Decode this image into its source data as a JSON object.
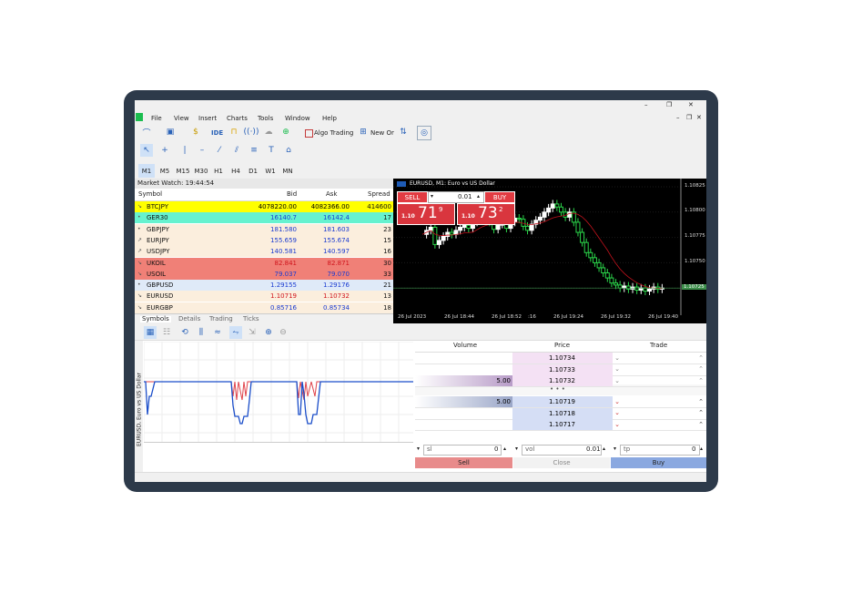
{
  "window": {
    "minimize": "–",
    "maximize": "❐",
    "close": "✕"
  },
  "menu": [
    "File",
    "View",
    "Insert",
    "Charts",
    "Tools",
    "Window",
    "Help"
  ],
  "toolbar": {
    "ide": "IDE",
    "algo_trading": "Algo Trading",
    "new_order": "New Or"
  },
  "timeframes": [
    "M1",
    "M5",
    "M15",
    "M30",
    "H1",
    "H4",
    "D1",
    "W1",
    "MN"
  ],
  "market_watch": {
    "title": "Market Watch: 19:44:54",
    "columns": {
      "symbol": "Symbol",
      "bid": "Bid",
      "ask": "Ask",
      "spread": "Spread"
    },
    "rows": [
      {
        "symbol": "BTCJPY",
        "bid": "4078220.00",
        "ask": "4082366.00",
        "spread": "414600",
        "bg": "#ffff00",
        "color": "#000000",
        "arrow": "↘"
      },
      {
        "symbol": "GER30",
        "bid": "16140.7",
        "ask": "16142.4",
        "spread": "17",
        "bg": "#66f2cf",
        "color": "#1a3bd1",
        "arrow": "•"
      },
      {
        "symbol": "GBPJPY",
        "bid": "181.580",
        "ask": "181.603",
        "spread": "23",
        "bg": "#fbeedd",
        "color": "#1a3bd1",
        "arrow": "•"
      },
      {
        "symbol": "EURJPY",
        "bid": "155.659",
        "ask": "155.674",
        "spread": "15",
        "bg": "#fbeedd",
        "color": "#1a3bd1",
        "arrow": "↗"
      },
      {
        "symbol": "USDJPY",
        "bid": "140.581",
        "ask": "140.597",
        "spread": "16",
        "bg": "#fbeedd",
        "color": "#1a3bd1",
        "arrow": "↗"
      },
      {
        "symbol": "UKOIL",
        "bid": "82.841",
        "ask": "82.871",
        "spread": "30",
        "bg": "#f08077",
        "color": "#d0141c",
        "arrow": "↘"
      },
      {
        "symbol": "USOIL",
        "bid": "79.037",
        "ask": "79.070",
        "spread": "33",
        "bg": "#f08077",
        "color": "#1a3bd1",
        "arrow": "↘"
      },
      {
        "symbol": "GBPUSD",
        "bid": "1.29155",
        "ask": "1.29176",
        "spread": "21",
        "bg": "#dfeaf8",
        "color": "#1a3bd1",
        "arrow": "•"
      },
      {
        "symbol": "EURUSD",
        "bid": "1.10719",
        "ask": "1.10732",
        "spread": "13",
        "bg": "#fbeedd",
        "color": "#d0141c",
        "arrow": "↘"
      },
      {
        "symbol": "EURGBP",
        "bid": "0.85716",
        "ask": "0.85734",
        "spread": "18",
        "bg": "#fbeedd",
        "color": "#1a3bd1",
        "arrow": "↘"
      }
    ],
    "tabs": [
      "Symbols",
      "Details",
      "Trading",
      "Ticks"
    ]
  },
  "chart": {
    "title": "EURUSD, M1:  Euro vs US Dollar",
    "sell": "SELL",
    "buy": "BUY",
    "lot": "0.01",
    "sell_price_small": "1.10",
    "sell_price_big": "71",
    "sell_price_sup": "9",
    "buy_price_small": "1.10",
    "buy_price_big": "73",
    "buy_price_sup": "2",
    "price_labels": [
      "1.10825",
      "1.10800",
      "1.10775",
      "1.10750",
      "1.10725"
    ],
    "current_price": "1.10725",
    "time_labels": [
      "26 Jul 2023",
      "26 Jul 18:44",
      "26 Jul 18:52",
      ":16",
      "26 Jul 19:24",
      "26 Jul 19:32",
      "26 Jul 19:40"
    ]
  },
  "depth": {
    "side_label": "EURUSD, Euro vs US Dollar",
    "headers": {
      "volume": "Volume",
      "price": "Price",
      "trade": "Trade"
    },
    "ask_rows": [
      {
        "volume": "",
        "price": "1.10734"
      },
      {
        "volume": "",
        "price": "1.10733"
      },
      {
        "volume": "5.00",
        "price": "1.10732"
      }
    ],
    "separator": "• • •",
    "bid_rows": [
      {
        "volume": "5.00",
        "price": "1.10719"
      },
      {
        "volume": "",
        "price": "1.10718"
      },
      {
        "volume": "",
        "price": "1.10717"
      }
    ],
    "sl_label": "sl",
    "sl_value": "0",
    "vol_label": "vol",
    "vol_value": "0.01",
    "tp_label": "tp",
    "tp_value": "0",
    "sell": "Sell",
    "close": "Close",
    "buy": "Buy"
  },
  "colors": {
    "bull": "#ffffff",
    "bear": "#2bd64a",
    "ma": "#c1121c",
    "sell_btn": "#d9363e",
    "buy_btn": "#d9363e"
  }
}
